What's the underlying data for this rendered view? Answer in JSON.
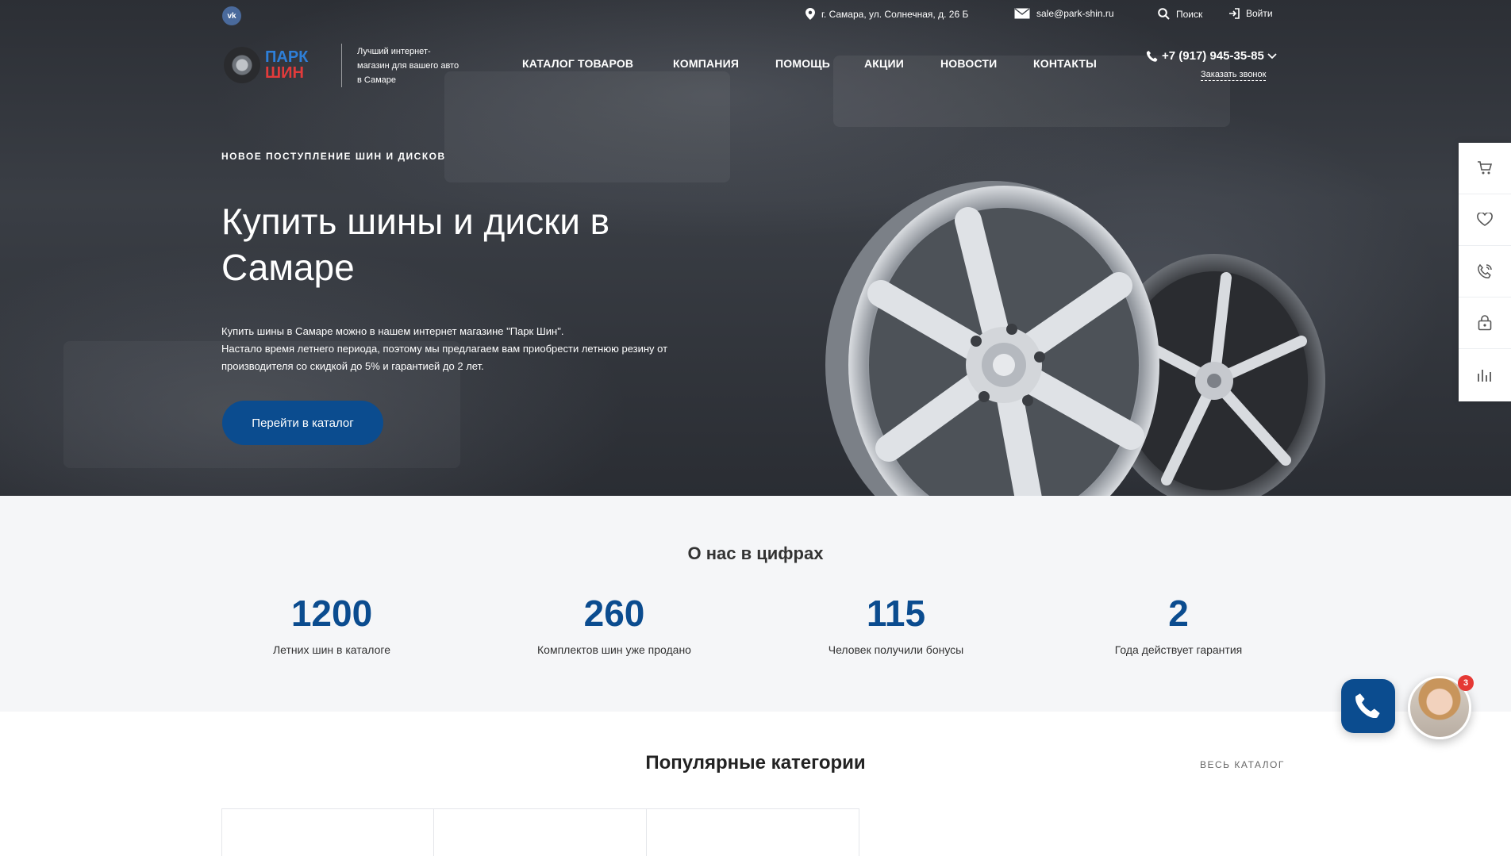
{
  "topbar": {
    "vk_label": "vk",
    "address": "г. Самара, ул. Солнечная, д. 26 Б",
    "email": "sale@park-shin.ru",
    "search_label": "Поиск",
    "login_label": "Войти"
  },
  "header": {
    "logo_line1": "ПАРК",
    "logo_line2": "ШИН",
    "slogan": "Лучший интернет-магазин для вашего авто в Самаре",
    "nav": [
      {
        "label": "КАТАЛОГ ТОВАРОВ"
      },
      {
        "label": "КОМПАНИЯ"
      },
      {
        "label": "ПОМОЩЬ"
      },
      {
        "label": "АКЦИИ"
      },
      {
        "label": "НОВОСТИ"
      },
      {
        "label": "КОНТАКТЫ"
      }
    ],
    "phone": "+7 (917) 945-35-85",
    "callback_label": "Заказать звонок"
  },
  "hero": {
    "eyebrow": "НОВОЕ ПОСТУПЛЕНИЕ ШИН И ДИСКОВ",
    "title": "Купить шины и диски в Самаре",
    "text_line1": "Купить шины в Самаре можно в нашем интернет магазине \"Парк Шин\".",
    "text_line2": "Настало время летнего периода, поэтому мы предлагаем вам приобрести летнюю резину от производителя со скидкой до 5% и гарантией до 2 лет.",
    "button_label": "Перейти в каталог"
  },
  "side_panel": {
    "icons": [
      "cart-icon",
      "heart-icon",
      "phone-ring-icon",
      "lock-bag-icon",
      "compare-icon"
    ]
  },
  "stats": {
    "title": "О нас в цифрах",
    "items": [
      {
        "value": "1200",
        "label": "Летних шин в каталоге"
      },
      {
        "value": "260",
        "label": "Комплектов шин уже продано"
      },
      {
        "value": "115",
        "label": "Человек получили бонусы"
      },
      {
        "value": "2",
        "label": "Года действует гарантия"
      }
    ]
  },
  "popular": {
    "title": "Популярные категории",
    "all_link": "ВЕСЬ КАТАЛОГ"
  },
  "widgets": {
    "chat_badge": "3"
  },
  "colors": {
    "accent": "#0b4c8f",
    "logo_blue": "#2e7fd8",
    "logo_red": "#e23b3b",
    "badge_red": "#e53935"
  }
}
